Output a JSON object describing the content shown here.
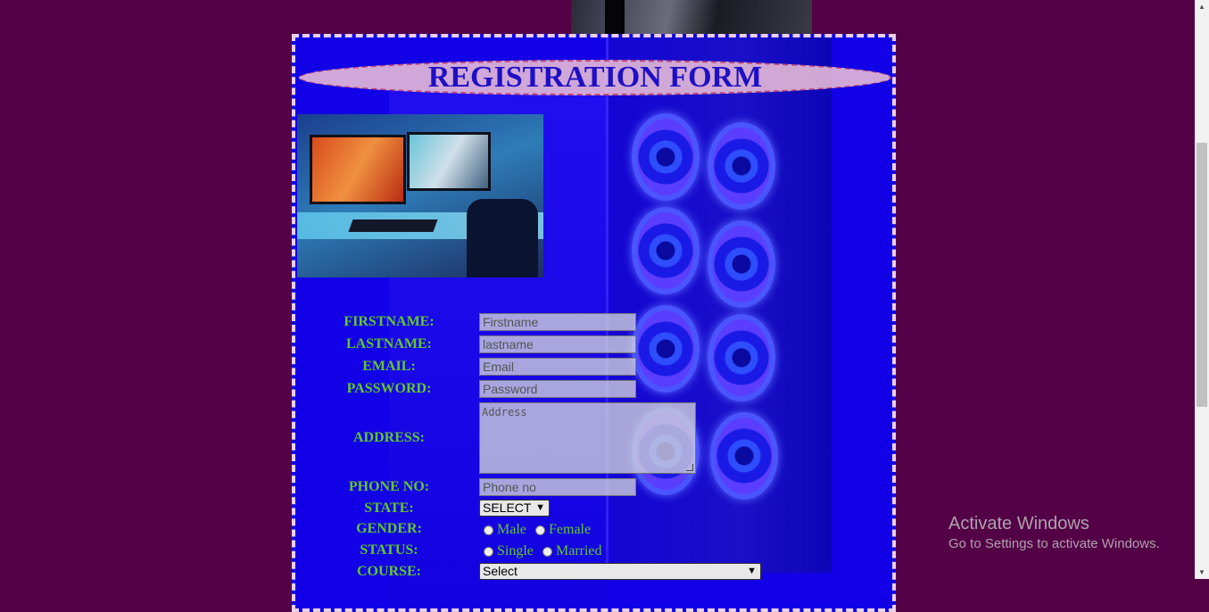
{
  "form": {
    "title": "REGISTRATION FORM",
    "fields": {
      "firstname": {
        "label": "FIRSTNAME:",
        "placeholder": "Firstname",
        "value": ""
      },
      "lastname": {
        "label": "LASTNAME:",
        "placeholder": "lastname",
        "value": ""
      },
      "email": {
        "label": "EMAIL:",
        "placeholder": "Email",
        "value": ""
      },
      "password": {
        "label": "PASSWORD:",
        "placeholder": "Password",
        "value": ""
      },
      "address": {
        "label": "ADDRESS:",
        "placeholder": "Address",
        "value": ""
      },
      "phone": {
        "label": "PHONE NO:",
        "placeholder": "Phone no",
        "value": ""
      },
      "state": {
        "label": "STATE:",
        "selected": "SELECT"
      },
      "gender": {
        "label": "GENDER:",
        "options": [
          "Male",
          "Female"
        ]
      },
      "status": {
        "label": "STATUS:",
        "options": [
          "Single",
          "Married"
        ]
      },
      "course": {
        "label": "COURSE:",
        "selected": "Select"
      }
    }
  },
  "watermark": {
    "title": "Activate Windows",
    "subtitle": "Go to Settings to activate Windows."
  },
  "colors": {
    "page_background": "#540047",
    "form_background": "#1200e6",
    "label_color": "#62c82c",
    "title_color": "#1f0fc4"
  }
}
